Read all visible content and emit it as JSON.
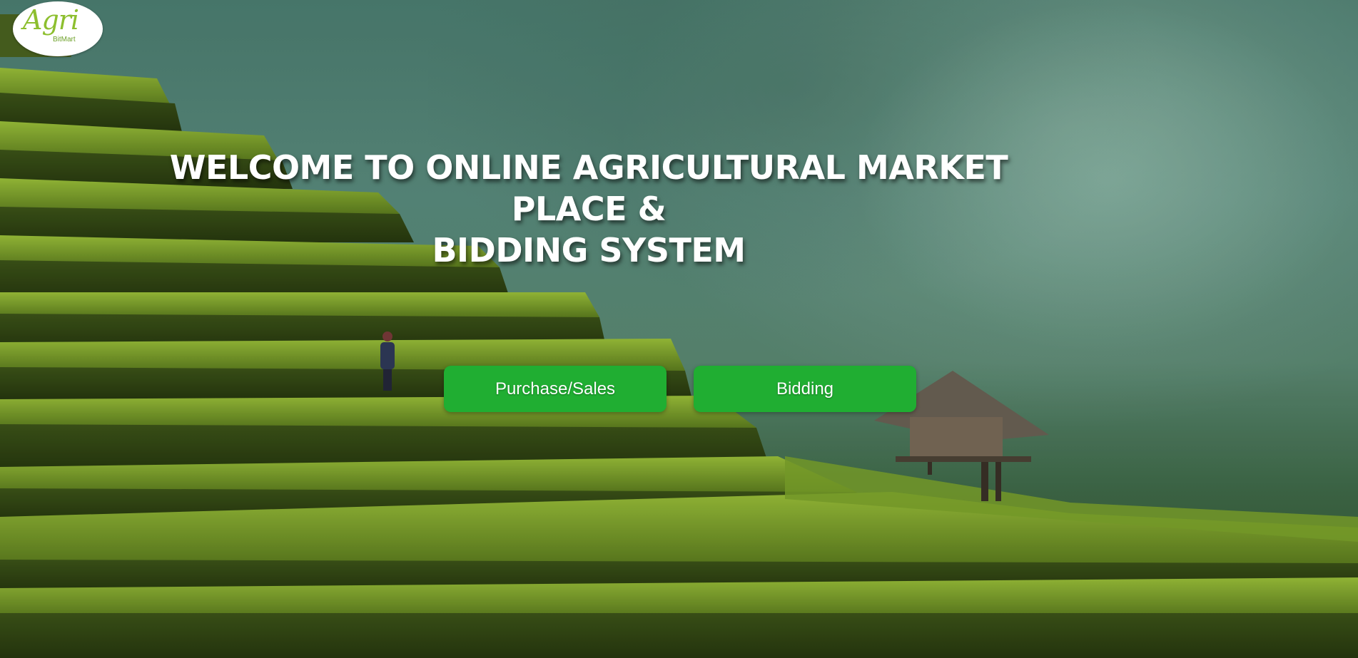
{
  "logo": {
    "main_text": "Agri",
    "sub_text": "BitMart"
  },
  "hero": {
    "heading_line1": "WELCOME TO ONLINE AGRICULTURAL MARKET PLACE &",
    "heading_line2": "BIDDING SYSTEM"
  },
  "actions": {
    "purchase_label": "Purchase/Sales",
    "bidding_label": "Bidding"
  },
  "colors": {
    "button_bg": "#20ae32",
    "logo_green": "#8dbf2f"
  }
}
